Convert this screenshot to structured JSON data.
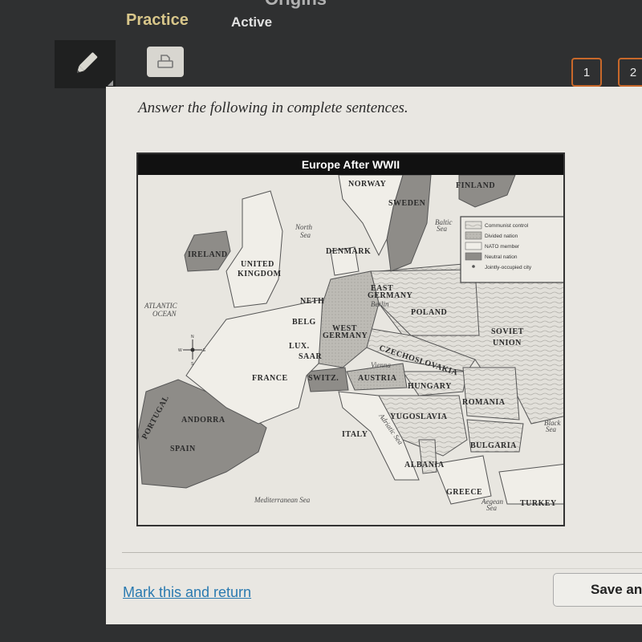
{
  "header": {
    "title_fragment": "Origins",
    "tabs": [
      {
        "label": "Practice",
        "state": "selected"
      },
      {
        "label": "Active",
        "state": "normal"
      }
    ]
  },
  "toolbar": {
    "pencil_icon": "pencil-icon",
    "print_icon": "printer-icon",
    "pages": [
      "1",
      "2"
    ]
  },
  "question": {
    "instructions": "Answer the following in complete sentences."
  },
  "map": {
    "title": "Europe After WWII",
    "legend": [
      {
        "label": "Communist control",
        "pattern": "wavy-lines",
        "color": "#dcdad4"
      },
      {
        "label": "Divided nation",
        "pattern": "dotted",
        "color": "#b8b6b0"
      },
      {
        "label": "NATO member",
        "pattern": "plain",
        "color": "#f0eee8"
      },
      {
        "label": "Neutral nation",
        "pattern": "solid-dark",
        "color": "#8e8c88"
      },
      {
        "label": "Jointly-occupied city",
        "pattern": "dot-marker",
        "color": "#555555"
      }
    ],
    "countries": {
      "norway": "NORWAY",
      "sweden": "SWEDEN",
      "finland": "FINLAND",
      "denmark": "DENMARK",
      "ireland": "IRELAND",
      "uk_line1": "UNITED",
      "uk_line2": "KINGDOM",
      "neth": "NETH",
      "belg": "BELG",
      "lux": "LUX.",
      "saar": "SAAR",
      "france": "FRANCE",
      "east_germany_1": "EAST",
      "east_germany_2": "GERMANY",
      "west_germany_1": "WEST",
      "west_germany_2": "GERMANY",
      "poland": "POLAND",
      "soviet_1": "SOVIET",
      "soviet_2": "UNION",
      "czech": "CZECHOSLOVAKIA",
      "switz": "SWITZ.",
      "austria": "AUSTRIA",
      "hungary": "HUNGARY",
      "romania": "ROMANIA",
      "yugoslavia": "YUGOSLAVIA",
      "italy": "ITALY",
      "bulgaria": "BULGARIA",
      "albania": "ALBANIA",
      "greece": "GREECE",
      "turkey": "TURKEY",
      "portugal": "PORTUGAL",
      "andorra": "ANDORRA",
      "spain": "SPAIN"
    },
    "cities": {
      "berlin": "Berlin",
      "vienna": "Vienna"
    },
    "seas": {
      "north_1": "North",
      "north_2": "Sea",
      "baltic_1": "Baltic",
      "baltic_2": "Sea",
      "atlantic_1": "ATLANTIC",
      "atlantic_2": "OCEAN",
      "mediterranean": "Mediterranean Sea",
      "adriatic": "Adriatic Sea",
      "black_1": "Black",
      "black_2": "Sea",
      "aegean_1": "Aegean",
      "aegean_2": "Sea"
    },
    "compass": {
      "n": "N",
      "s": "S",
      "e": "E",
      "w": "W"
    }
  },
  "footer": {
    "mark_link": "Mark this and return",
    "save_button": "Save and Exit"
  }
}
